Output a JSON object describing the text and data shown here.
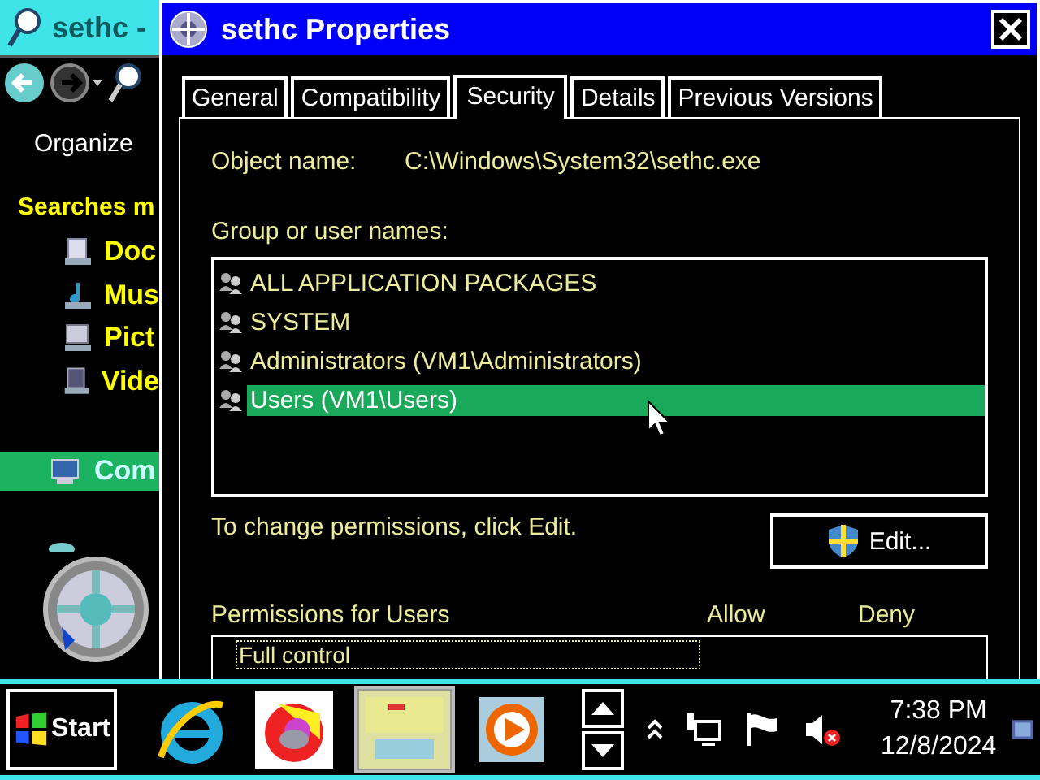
{
  "explorer": {
    "title": "sethc -",
    "toolbar_label": "Organize",
    "section": "Searches m",
    "library_items": [
      {
        "label": "Doc",
        "kind": "documents"
      },
      {
        "label": "Mus",
        "kind": "music"
      },
      {
        "label": "Pict",
        "kind": "pictures"
      },
      {
        "label": "Vide",
        "kind": "videos"
      }
    ],
    "computer_item": {
      "label": "Com",
      "selected": true
    }
  },
  "dialog": {
    "title": "sethc Properties",
    "tabs": [
      {
        "label": "General",
        "selected": false
      },
      {
        "label": "Compatibility",
        "selected": false
      },
      {
        "label": "Security",
        "selected": true
      },
      {
        "label": "Details",
        "selected": false
      },
      {
        "label": "Previous Versions",
        "selected": false
      }
    ],
    "object_name_label": "Object name:",
    "object_name": "C:\\Windows\\System32\\sethc.exe",
    "group_label": "Group or user names:",
    "groups": [
      {
        "name": "ALL APPLICATION PACKAGES",
        "selected": false
      },
      {
        "name": "SYSTEM",
        "selected": false
      },
      {
        "name": "Administrators (VM1\\Administrators)",
        "selected": false
      },
      {
        "name": "Users (VM1\\Users)",
        "selected": true
      }
    ],
    "edit_hint": "To change permissions, click Edit.",
    "edit_button": "Edit...",
    "permissions_label": "Permissions for Users",
    "columns": [
      "Allow",
      "Deny"
    ],
    "permissions": [
      {
        "name": "Full control",
        "selected": true
      }
    ]
  },
  "taskbar": {
    "start": "Start",
    "apps": [
      {
        "kind": "browser-e",
        "selected": false
      },
      {
        "kind": "browser-fox",
        "selected": false
      },
      {
        "kind": "window-thumb",
        "selected": true
      },
      {
        "kind": "media",
        "selected": false
      }
    ],
    "time": "7:38 PM",
    "date": "12/8/2024"
  }
}
